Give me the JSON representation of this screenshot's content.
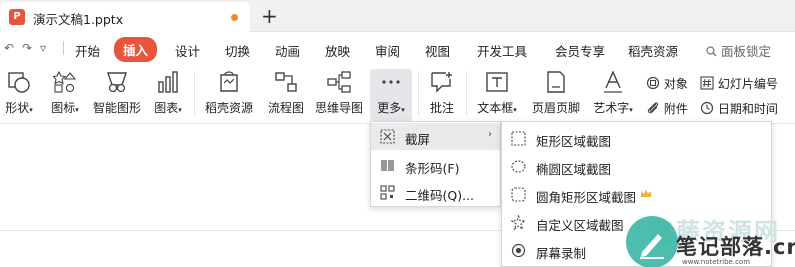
{
  "titlebar": {
    "doc_name": "演示文稿1.pptx",
    "logo_letter": "P",
    "accent": "#e8553d",
    "unsaved_dot_color": "#f08a24",
    "close_glyph": "✕",
    "add_glyph": "+"
  },
  "menubar": {
    "undo_glyph": "↶",
    "redo_glyph": "↷",
    "dropdown_glyph": "▿",
    "items": [
      {
        "label": "开始"
      },
      {
        "label": "插入",
        "active": true
      },
      {
        "label": "设计"
      },
      {
        "label": "切换"
      },
      {
        "label": "动画"
      },
      {
        "label": "放映"
      },
      {
        "label": "审阅"
      },
      {
        "label": "视图"
      },
      {
        "label": "开发工具"
      },
      {
        "label": "会员专享"
      },
      {
        "label": "稻壳资源"
      }
    ],
    "search_label": "面板锁定"
  },
  "ribbon": {
    "shapes": "形状",
    "icons": "图标",
    "smartart": "智能图形",
    "chart": "图表",
    "docer": "稻壳资源",
    "flowchart": "流程图",
    "mindmap": "思维导图",
    "more": "更多",
    "comment": "批注",
    "textbox": "文本框",
    "headerfooter": "页眉页脚",
    "wordart": "艺术字",
    "object": "对象",
    "attachment": "附件",
    "slidenum": "幻灯片编号",
    "datetime": "日期和时间"
  },
  "menu_more": {
    "items": [
      {
        "label": "截屏"
      },
      {
        "label": "条形码(F)"
      },
      {
        "label": "二维码(Q)..."
      }
    ]
  },
  "menu_screenshot": {
    "items": [
      {
        "label": "矩形区域截图"
      },
      {
        "label": "椭圆区域截图"
      },
      {
        "label": "圆角矩形区域截图"
      },
      {
        "label": "自定义区域截图"
      },
      {
        "label": "屏幕录制"
      }
    ],
    "crown_color": "#f0b236"
  },
  "watermark": {
    "faded_text": "路藤资源网",
    "main_text": "笔记部落.cn",
    "url": "www.notetribe.com"
  }
}
